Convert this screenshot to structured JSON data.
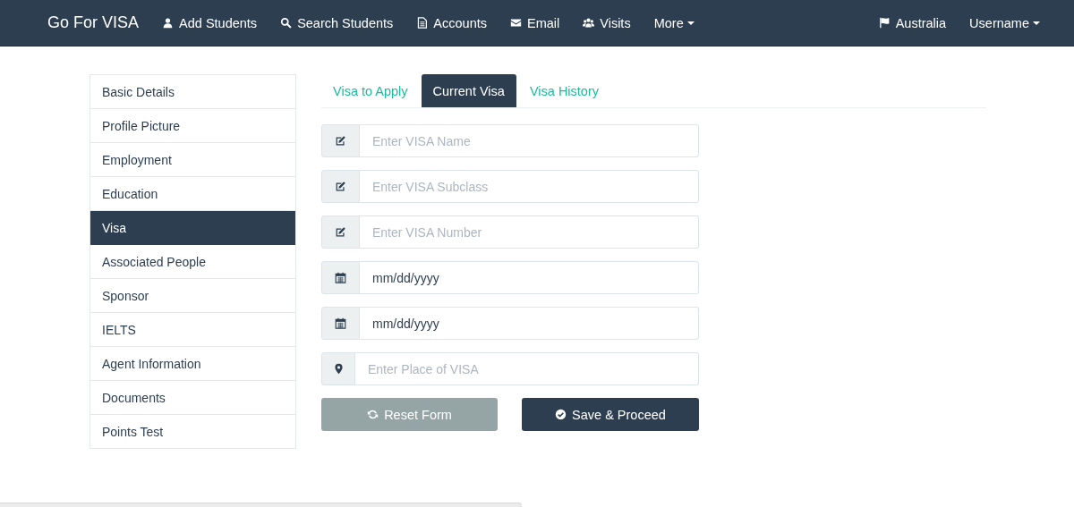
{
  "navbar": {
    "brand": "Go For VISA",
    "items": [
      {
        "label": "Add Students",
        "dropdown": false
      },
      {
        "label": "Search Students",
        "dropdown": false
      },
      {
        "label": "Accounts",
        "dropdown": false
      },
      {
        "label": "Email",
        "dropdown": false
      },
      {
        "label": "Visits",
        "dropdown": false
      },
      {
        "label": "More",
        "dropdown": true
      }
    ],
    "right_items": [
      {
        "label": "Australia",
        "dropdown": false
      },
      {
        "label": "Username",
        "dropdown": true
      }
    ]
  },
  "sidebar": {
    "items": [
      {
        "label": "Basic Details",
        "selected": false
      },
      {
        "label": "Profile Picture",
        "selected": false
      },
      {
        "label": "Employment",
        "selected": false
      },
      {
        "label": "Education",
        "selected": false
      },
      {
        "label": "Visa",
        "selected": true
      },
      {
        "label": "Associated People",
        "selected": false
      },
      {
        "label": "Sponsor",
        "selected": false
      },
      {
        "label": "IELTS",
        "selected": false
      },
      {
        "label": "Agent Information",
        "selected": false
      },
      {
        "label": "Documents",
        "selected": false
      },
      {
        "label": "Points Test",
        "selected": false
      }
    ]
  },
  "tabs": [
    {
      "label": "Visa to Apply",
      "selected": false
    },
    {
      "label": "Current Visa",
      "selected": true
    },
    {
      "label": "Visa History",
      "selected": false
    }
  ],
  "fields": [
    {
      "kind": "text",
      "placeholder": "Enter VISA Name"
    },
    {
      "kind": "text",
      "placeholder": "Enter VISA Subclass"
    },
    {
      "kind": "text",
      "placeholder": "Enter VISA Number"
    },
    {
      "kind": "date",
      "placeholder": "mm/dd/yyyy"
    },
    {
      "kind": "date",
      "placeholder": "mm/dd/yyyy"
    },
    {
      "kind": "place",
      "placeholder": "Enter Place of VISA"
    }
  ],
  "buttons": [
    {
      "kind": "reset",
      "label": "Reset Form"
    },
    {
      "kind": "save",
      "label": "Save & Proceed"
    }
  ]
}
